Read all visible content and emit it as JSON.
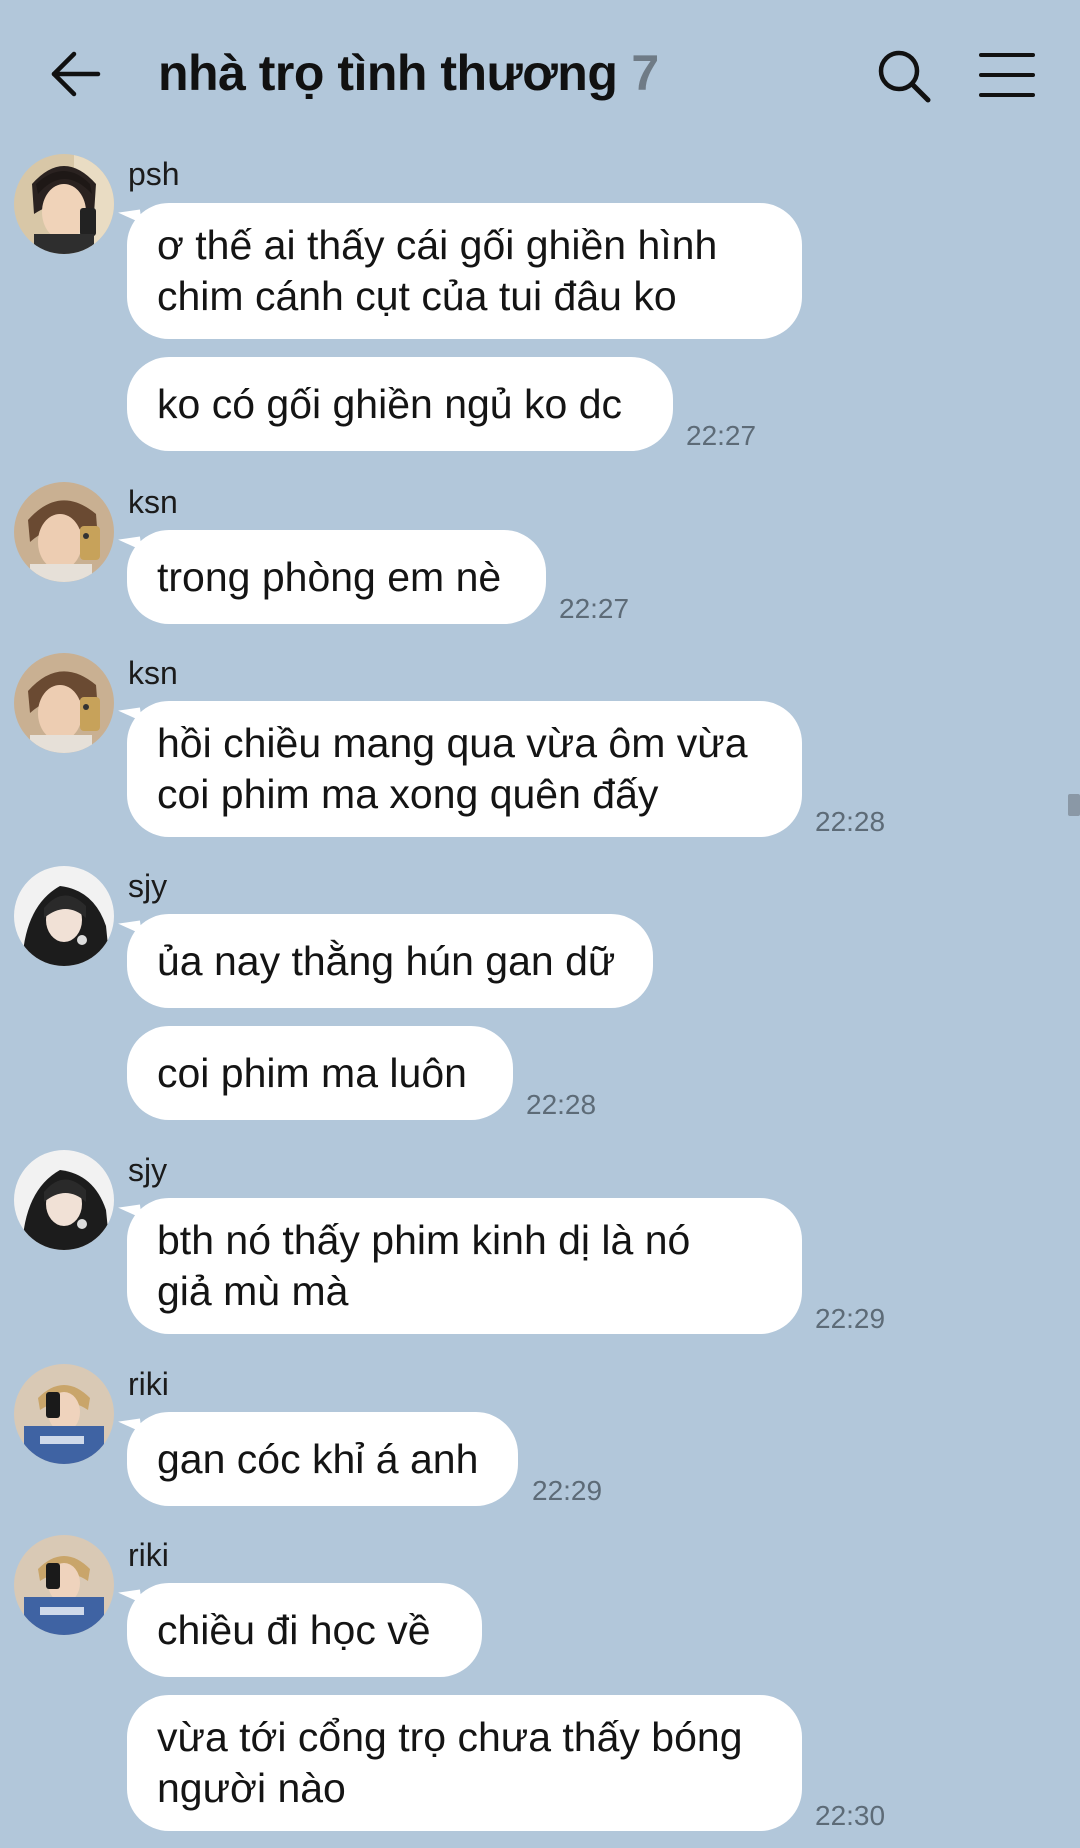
{
  "header": {
    "title": "nhà trọ tình thương",
    "member_count": "7",
    "icons": [
      "back-arrow-icon",
      "search-icon",
      "menu-icon"
    ]
  },
  "messages": [
    {
      "sender": "psh",
      "lines": [
        "ơ thế ai thấy cái gối ghiền hình",
        "chim cánh cụt của tui đâu ko"
      ],
      "time": ""
    },
    {
      "sender": "",
      "lines": [
        "ko có gối ghiền ngủ ko dc"
      ],
      "time": "22:27"
    },
    {
      "sender": "ksn",
      "lines": [
        "trong phòng em nè"
      ],
      "time": "22:27"
    },
    {
      "sender": "ksn",
      "lines": [
        "hồi chiều mang qua vừa ôm vừa",
        "coi phim ma xong quên đấy"
      ],
      "time": "22:28"
    },
    {
      "sender": "sjy",
      "lines": [
        "ủa nay thằng hún gan dữ"
      ],
      "time": ""
    },
    {
      "sender": "",
      "lines": [
        "coi phim ma luôn"
      ],
      "time": "22:28"
    },
    {
      "sender": "sjy",
      "lines": [
        "bth nó thấy phim kinh dị là nó",
        "giả mù mà"
      ],
      "time": "22:29"
    },
    {
      "sender": "riki",
      "lines": [
        "gan cóc khỉ á anh"
      ],
      "time": "22:29"
    },
    {
      "sender": "riki",
      "lines": [
        "chiều đi học về"
      ],
      "time": ""
    },
    {
      "sender": "",
      "lines": [
        "vừa tới cổng trọ chưa thấy bóng",
        "người nào"
      ],
      "time": "22:30"
    }
  ],
  "colors": {
    "background": "#b2c7da",
    "bubble": "#ffffff",
    "timestamp": "#5d6b77"
  }
}
